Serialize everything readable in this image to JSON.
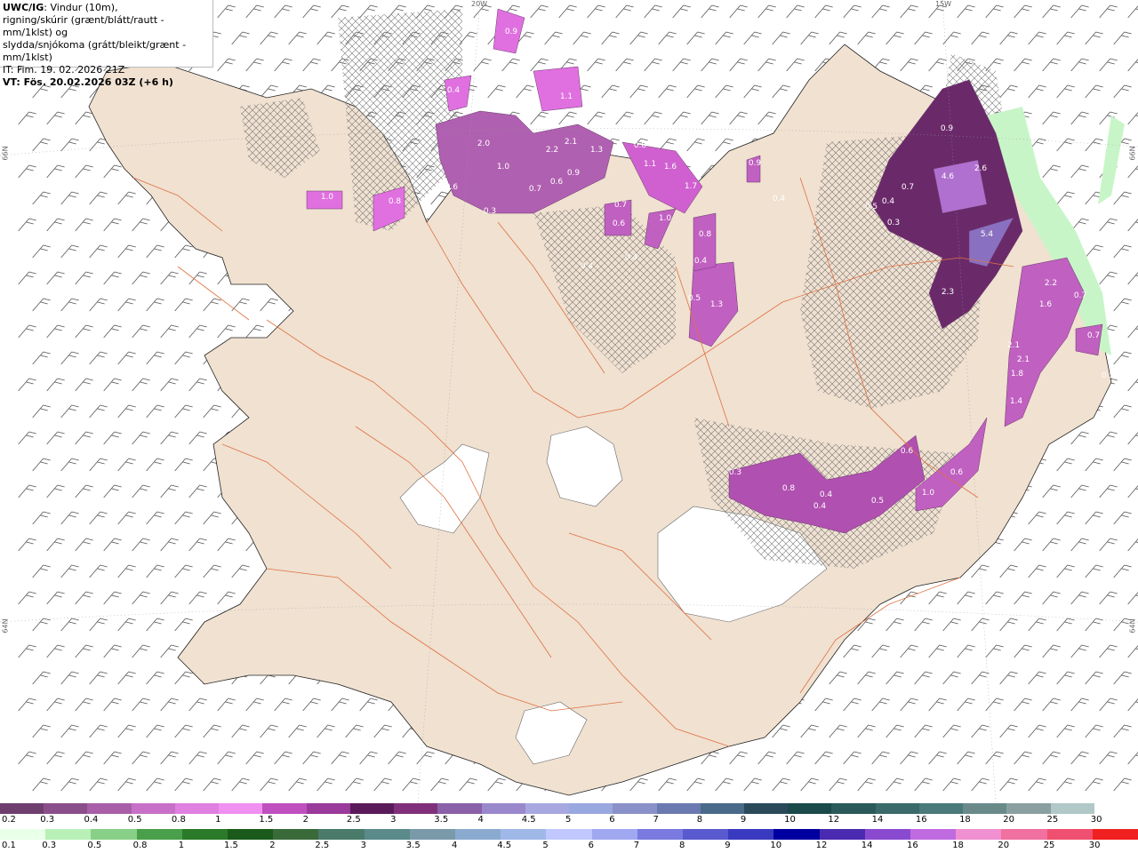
{
  "header": {
    "model": "UWC/IG",
    "desc1": ": Vindur (10m),",
    "desc2": "rigning/skúrir (grænt/blátt/rautt - mm/1klst) og",
    "desc3": "slydda/snjókoma (grátt/bleikt/grænt - mm/1klst)",
    "it": "IT: Fim. 19. 02. 2026 21Z",
    "vt": "VT: Fös. 20.02.2026 03Z (+6 h)"
  },
  "grid_labels": {
    "lon20": "20W",
    "lon15": "15W",
    "lat66_left": "66N",
    "lat66_right": "66N",
    "lat64_left": "64N",
    "lat64_right": "64N"
  },
  "precip_labels": [
    "0.9",
    "0.4",
    "1.1",
    "2.0",
    "1.0",
    "0.6",
    "0.3",
    "2.2",
    "2.1",
    "0.7",
    "0.6",
    "0.9",
    "1.3",
    "0.8",
    "1.1",
    "1.6",
    "1.7",
    "0.7",
    "0.6",
    "0.4",
    "0.4",
    "1.0",
    "0.8",
    "0.4",
    "0.5",
    "1.3",
    "0.4",
    "1.0",
    "0.8",
    "0.9",
    "0.7",
    "0.4",
    "4.6",
    "2.6",
    "0.5",
    "0.3",
    "5.4",
    "2.3",
    "2.2",
    "1.6",
    "0.7",
    "2.1",
    "2.1",
    "1.8",
    "1.4",
    "0.3",
    "0.8",
    "0.4",
    "0.4",
    "0.5",
    "0.6",
    "1.0",
    "0.6",
    "0.9",
    "0.7",
    "0.5"
  ],
  "scale_top": {
    "labels": [
      "0.2",
      "0.3",
      "0.4",
      "0.5",
      "0.8",
      "1",
      "1.5",
      "2",
      "2.5",
      "3",
      "3.5",
      "4",
      "4.5",
      "5",
      "6",
      "7",
      "8",
      "9",
      "10",
      "12",
      "14",
      "16",
      "18",
      "20",
      "25",
      "30"
    ],
    "colors": [
      "#6e3f6e",
      "#8a4f8a",
      "#a85fa8",
      "#c870c8",
      "#e080e0",
      "#f090f0",
      "#c050c0",
      "#9a3a9a",
      "#5a1a5a",
      "#80307a",
      "#8a60a8",
      "#9a88cc",
      "#a8a8e0",
      "#9aa8e0",
      "#8a90c8",
      "#6a7ab0",
      "#4a6a8a",
      "#2a4a5a",
      "#1a4a4a",
      "#2a5a5a",
      "#3a6a6a",
      "#4a7a7a",
      "#6a8a8a",
      "#8aa0a0",
      "#b0c8c8",
      "#ffffff"
    ]
  },
  "scale_bottom": {
    "labels": [
      "0.1",
      "0.3",
      "0.5",
      "0.8",
      "1",
      "1.5",
      "2",
      "2.5",
      "3",
      "3.5",
      "4",
      "4.5",
      "5",
      "6",
      "7",
      "8",
      "9",
      "10",
      "12",
      "14",
      "16",
      "18",
      "20",
      "25",
      "30"
    ],
    "colors": [
      "#e8ffe8",
      "#b8f0b8",
      "#88d088",
      "#4aa04a",
      "#2a7a2a",
      "#1a5a1a",
      "#3a6a3a",
      "#4a7a6a",
      "#5a8a8a",
      "#7a9aaa",
      "#8aaad0",
      "#a0b8e8",
      "#c0c8ff",
      "#a0a8f0",
      "#7a7ae0",
      "#5a5ad0",
      "#3a3ac0",
      "#0000a0",
      "#4a2ab0",
      "#8a4ad0",
      "#c06ae0",
      "#f090d0",
      "#f070a0",
      "#f05070",
      "#f02020"
    ]
  }
}
